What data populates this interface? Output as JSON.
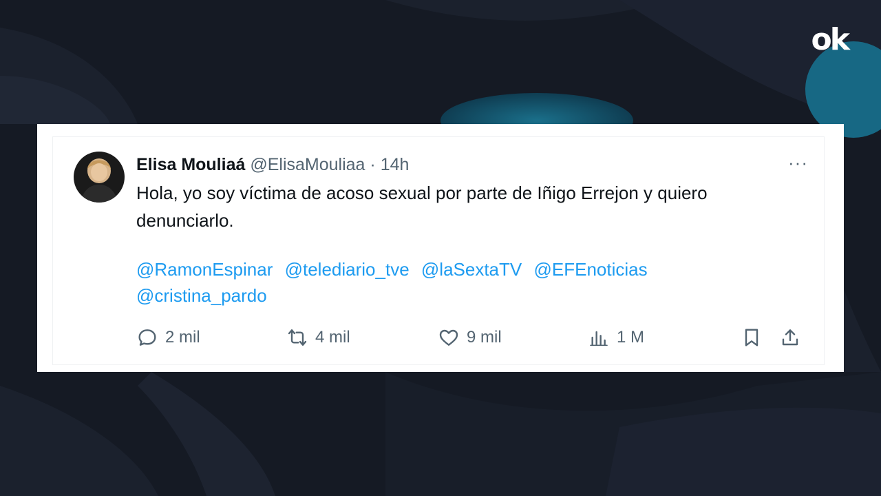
{
  "brand": {
    "logo_o": "o",
    "logo_k": "k"
  },
  "tweet": {
    "display_name": "Elisa Mouliaá",
    "handle": "@ElisaMouliaa",
    "separator": "·",
    "time": "14h",
    "more": "···",
    "text": "Hola, yo soy víctima de acoso sexual por parte de Iñigo Errejon y quiero denunciarlo.",
    "mentions": [
      "@RamonEspinar",
      "@telediario_tve",
      "@laSextaTV",
      "@EFEnoticias",
      "@cristina_pardo"
    ]
  },
  "actions": {
    "replies": "2 mil",
    "retweets": "4 mil",
    "likes": "9 mil",
    "views": "1 M"
  },
  "icons": {
    "reply": "reply-icon",
    "retweet": "retweet-icon",
    "like": "heart-icon",
    "views": "views-icon",
    "bookmark": "bookmark-icon",
    "share": "share-icon",
    "more": "more-icon"
  },
  "colors": {
    "background": "#151a24",
    "link": "#1d9bf0",
    "muted": "#536471",
    "text": "#0f1419",
    "accent": "#1e9cd7"
  }
}
